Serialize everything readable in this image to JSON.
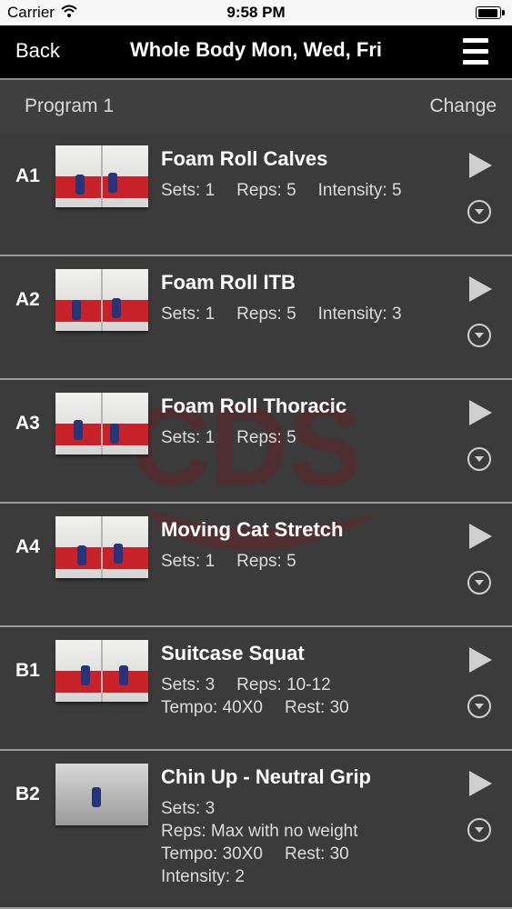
{
  "status": {
    "carrier": "Carrier",
    "time": "9:58 PM"
  },
  "nav": {
    "back_label": "Back",
    "title": "Whole Body Mon, Wed, Fri"
  },
  "program": {
    "label": "Program 1",
    "change_label": "Change"
  },
  "exercises": [
    {
      "code": "A1",
      "name": "Foam Roll Calves",
      "lines": [
        [
          "Sets: 1",
          "Reps: 5",
          "Intensity: 5"
        ]
      ]
    },
    {
      "code": "A2",
      "name": "Foam Roll ITB",
      "lines": [
        [
          "Sets: 1",
          "Reps: 5",
          "Intensity: 3"
        ]
      ]
    },
    {
      "code": "A3",
      "name": "Foam Roll Thoracic",
      "lines": [
        [
          "Sets: 1",
          "Reps: 5"
        ]
      ]
    },
    {
      "code": "A4",
      "name": "Moving Cat Stretch",
      "lines": [
        [
          "Sets: 1",
          "Reps: 5"
        ]
      ]
    },
    {
      "code": "B1",
      "name": "Suitcase Squat",
      "lines": [
        [
          "Sets: 3",
          "Reps: 10-12"
        ],
        [
          "Tempo: 40X0",
          "Rest: 30"
        ]
      ]
    },
    {
      "code": "B2",
      "name": "Chin Up - Neutral Grip",
      "lines": [
        [
          "Sets: 3"
        ],
        [
          "Reps: Max with no weight"
        ],
        [
          "Tempo: 30X0",
          "Rest: 30"
        ],
        [
          "Intensity: 2"
        ]
      ]
    }
  ],
  "colors": {
    "accent": "#8e1b22",
    "floor": "#c7222a"
  }
}
